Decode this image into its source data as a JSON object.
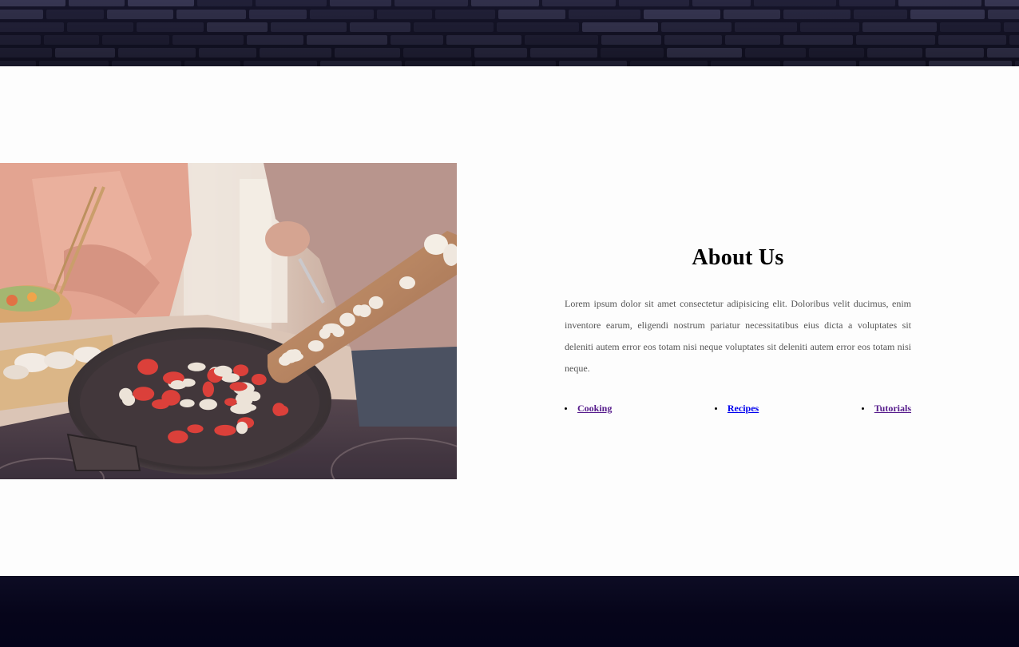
{
  "header": {
    "banner_image": "brick-wall-image"
  },
  "about": {
    "image": "cooking-photo",
    "title": "About Us",
    "text": "Lorem ipsum dolor sit amet consectetur adipisicing elit. Doloribus velit ducimus, enim inventore earum, eligendi nostrum pariatur necessitatibus eius dicta a voluptates sit deleniti autem error eos totam nisi neque voluptates sit deleniti autem error eos totam nisi neque.",
    "links": [
      {
        "label": "Cooking",
        "state": "visited"
      },
      {
        "label": "Recipes",
        "state": "unvisited"
      },
      {
        "label": "Tutorials",
        "state": "visited"
      }
    ]
  },
  "colors": {
    "link_visited": "#551a8b",
    "link_unvisited": "#0000ee",
    "banner_bg": "#22213a",
    "footer_bg": "#06051a"
  }
}
